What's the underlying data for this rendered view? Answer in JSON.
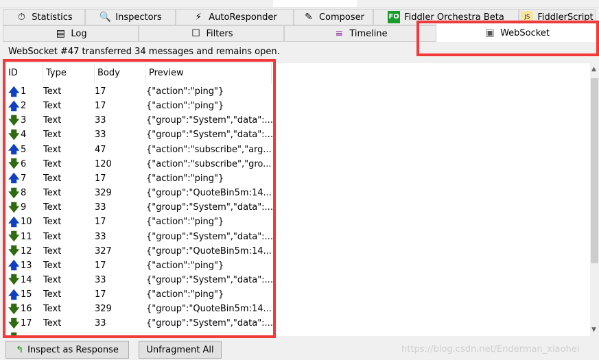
{
  "tabs_row1": [
    {
      "label": "Statistics",
      "icon": "stopwatch-icon",
      "glyph": "⏱"
    },
    {
      "label": "Inspectors",
      "icon": "magnifier-icon",
      "glyph": "🔍"
    },
    {
      "label": "AutoResponder",
      "icon": "lightning-icon",
      "glyph": "⚡"
    },
    {
      "label": "Composer",
      "icon": "pencil-icon",
      "glyph": "✎"
    },
    {
      "label": "Fiddler Orchestra Beta",
      "icon": "fo-icon",
      "glyph": "FO"
    },
    {
      "label": "FiddlerScript",
      "icon": "js-icon",
      "glyph": "JS"
    }
  ],
  "tabs_row2": [
    {
      "label": "Log",
      "icon": "log-icon",
      "glyph": "▤"
    },
    {
      "label": "Filters",
      "icon": "checkbox-icon",
      "glyph": "☐"
    },
    {
      "label": "Timeline",
      "icon": "timeline-icon",
      "glyph": "≡"
    },
    {
      "label": "WebSocket",
      "icon": "websocket-icon",
      "glyph": "▣"
    }
  ],
  "status": "WebSocket #47 transferred 34 messages and remains open.",
  "columns": [
    "ID",
    "Type",
    "Body",
    "Preview"
  ],
  "rows": [
    {
      "dir": "up",
      "id": "1",
      "type": "Text",
      "body": "17",
      "preview": "{\"action\":\"ping\"}"
    },
    {
      "dir": "up",
      "id": "2",
      "type": "Text",
      "body": "17",
      "preview": "{\"action\":\"ping\"}"
    },
    {
      "dir": "down",
      "id": "3",
      "type": "Text",
      "body": "33",
      "preview": "{\"group\":\"System\",\"data\":..."
    },
    {
      "dir": "down",
      "id": "4",
      "type": "Text",
      "body": "33",
      "preview": "{\"group\":\"System\",\"data\":..."
    },
    {
      "dir": "up",
      "id": "5",
      "type": "Text",
      "body": "47",
      "preview": "{\"action\":\"subscribe\",\"arg..."
    },
    {
      "dir": "down",
      "id": "6",
      "type": "Text",
      "body": "120",
      "preview": "{\"action\":\"subscribe\",\"gro..."
    },
    {
      "dir": "up",
      "id": "7",
      "type": "Text",
      "body": "17",
      "preview": "{\"action\":\"ping\"}"
    },
    {
      "dir": "down",
      "id": "8",
      "type": "Text",
      "body": "329",
      "preview": "{\"group\":\"QuoteBin5m:14..."
    },
    {
      "dir": "down",
      "id": "9",
      "type": "Text",
      "body": "33",
      "preview": "{\"group\":\"System\",\"data\":..."
    },
    {
      "dir": "up",
      "id": "10",
      "type": "Text",
      "body": "17",
      "preview": "{\"action\":\"ping\"}"
    },
    {
      "dir": "down",
      "id": "11",
      "type": "Text",
      "body": "33",
      "preview": "{\"group\":\"System\",\"data\":..."
    },
    {
      "dir": "down",
      "id": "12",
      "type": "Text",
      "body": "327",
      "preview": "{\"group\":\"QuoteBin5m:14..."
    },
    {
      "dir": "up",
      "id": "13",
      "type": "Text",
      "body": "17",
      "preview": "{\"action\":\"ping\"}"
    },
    {
      "dir": "down",
      "id": "14",
      "type": "Text",
      "body": "33",
      "preview": "{\"group\":\"System\",\"data\":..."
    },
    {
      "dir": "up",
      "id": "15",
      "type": "Text",
      "body": "17",
      "preview": "{\"action\":\"ping\"}"
    },
    {
      "dir": "down",
      "id": "16",
      "type": "Text",
      "body": "329",
      "preview": "{\"group\":\"QuoteBin5m:14..."
    },
    {
      "dir": "down",
      "id": "17",
      "type": "Text",
      "body": "33",
      "preview": "{\"group\":\"System\",\"data\":..."
    }
  ],
  "buttons": {
    "inspect": "Inspect as Response",
    "unfragment": "Unfragment All"
  },
  "watermark": "https://blog.csdn.net/Enderman_xiaohei",
  "colors": {
    "highlight": "#f23a3a",
    "up_arrow": "#1040c0",
    "down_arrow": "#2e6a10"
  }
}
